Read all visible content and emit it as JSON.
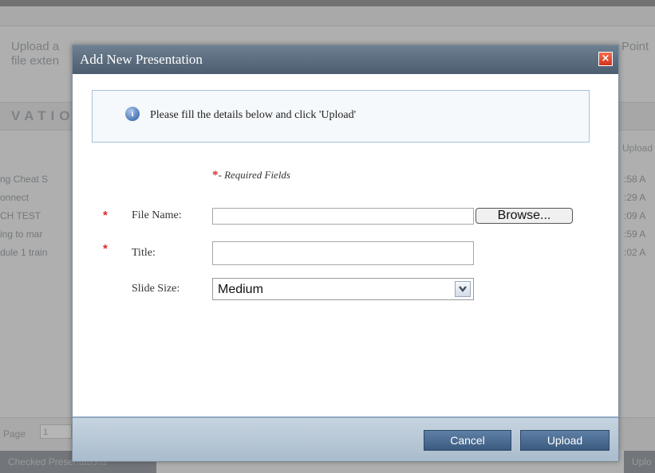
{
  "background": {
    "intro_line1": "Upload a",
    "intro_line2": "file exten",
    "intro_right_a": "Point",
    "section_title": "VATIO",
    "column_header": "Upload",
    "rows": [
      {
        "name": "ng Cheat S",
        "time": ":58 A"
      },
      {
        "name": "onnect",
        "time": ":29 A"
      },
      {
        "name": "CH TEST",
        "time": ":09 A"
      },
      {
        "name": "ing to mar",
        "time": ":59 A"
      },
      {
        "name": "dule 1 train",
        "time": ":02 A"
      }
    ],
    "pager_label": "Page",
    "pager_value": "1",
    "delete_button": "Checked Presentations",
    "upload_button": "Uplo"
  },
  "dialog": {
    "title": "Add New Presentation",
    "close_symbol": "×",
    "info_icon_glyph": "i",
    "info_text": "Please fill the details below and click 'Upload'",
    "required_star": "*",
    "required_note": "- Required Fields",
    "fields": {
      "file_name_label": "File Name:",
      "file_name_value": "",
      "browse_label": "Browse...",
      "title_label": "Title:",
      "title_value": "",
      "slide_size_label": "Slide Size:",
      "slide_size_value": "Medium",
      "slide_size_options": [
        "Medium"
      ]
    },
    "buttons": {
      "cancel": "Cancel",
      "upload": "Upload"
    },
    "icons": {
      "info": "info-icon",
      "close": "close-icon",
      "dropdown": "chevron-down-icon"
    }
  },
  "colors": {
    "titlebar": "#5b6d80",
    "button": "#4a6a92",
    "required": "#e0282a",
    "close": "#e04a30"
  }
}
